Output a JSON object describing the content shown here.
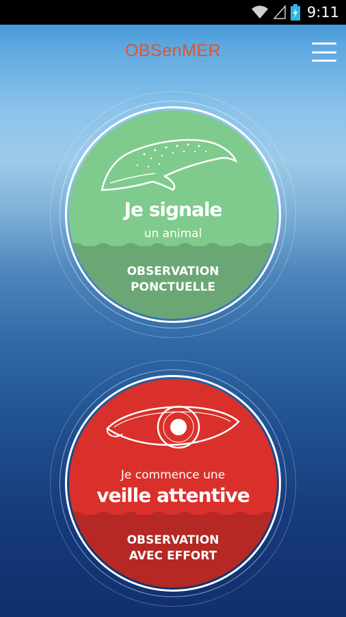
{
  "status_bar": {
    "time": "9:11"
  },
  "header": {
    "title": "OBSenMER"
  },
  "cards": {
    "spot": {
      "title_line1": "Je signale",
      "title_line2": "un animal",
      "band_line1": "OBSERVATION",
      "band_line2": "PONCTUELLE",
      "color": "#7fcb8d",
      "band_color": "#6aa775",
      "icon": "whale-icon"
    },
    "effort": {
      "title_line1": "Je commence une",
      "title_line2": "veille attentive",
      "band_line1": "OBSERVATION",
      "band_line2": "AVEC EFFORT",
      "color": "#d9302b",
      "band_color": "#b52823",
      "icon": "eye-icon"
    }
  },
  "colors": {
    "accent": "#e0542e"
  }
}
